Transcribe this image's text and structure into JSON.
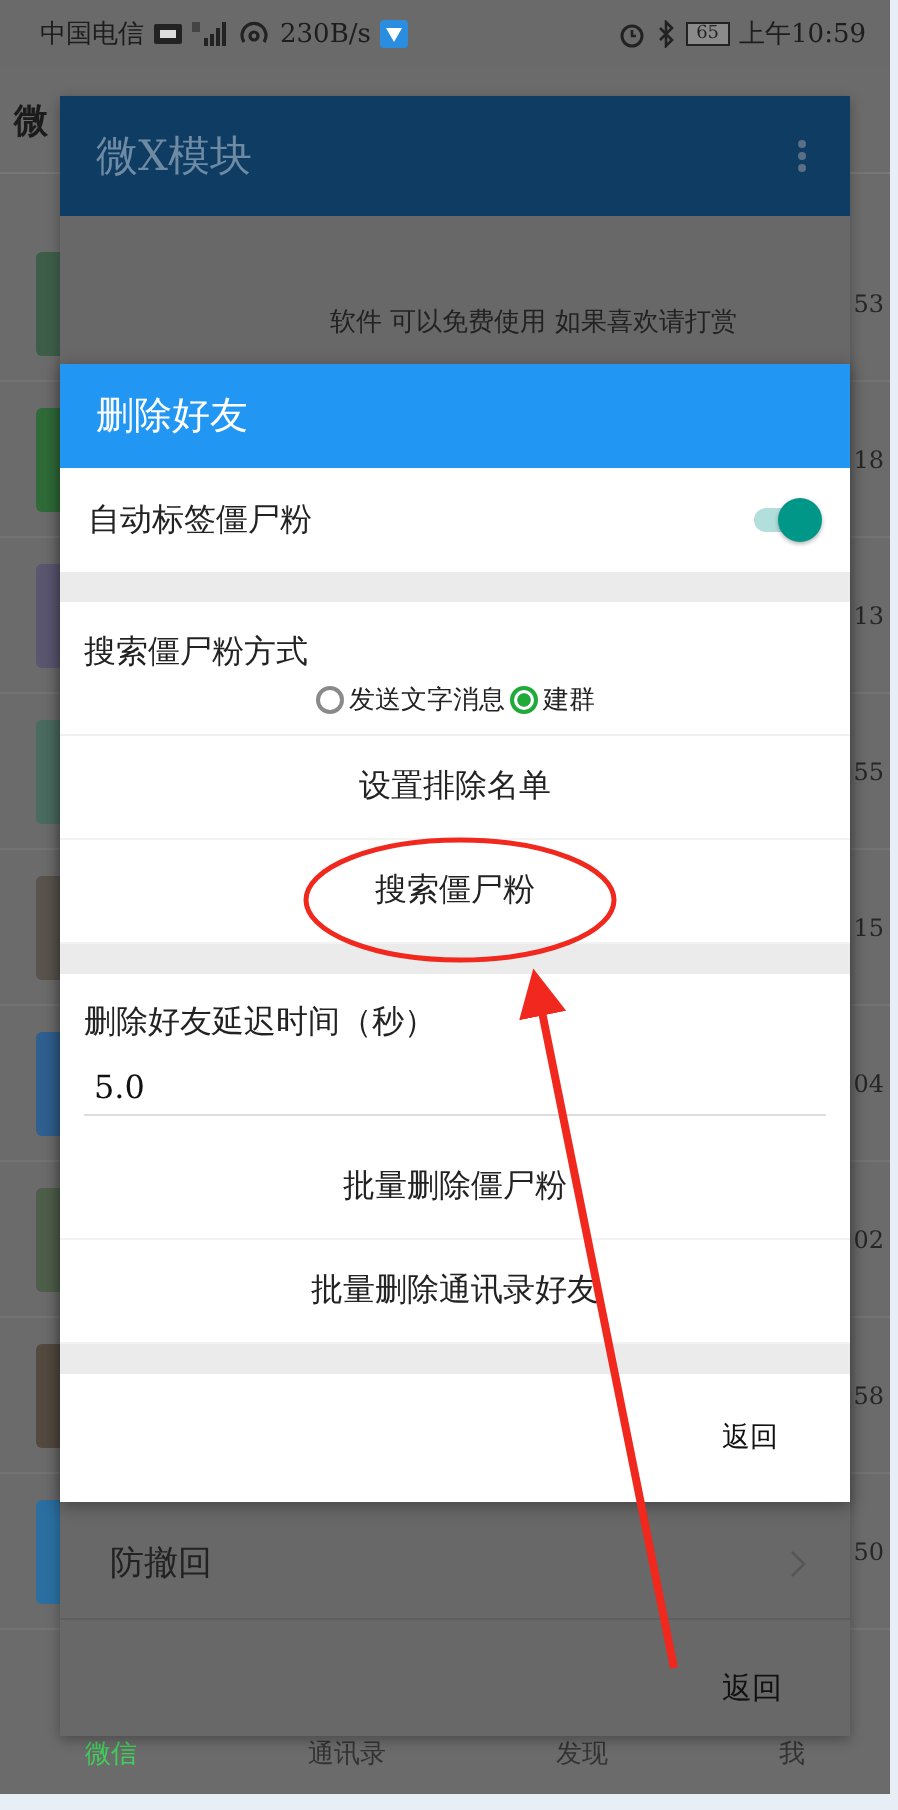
{
  "status_bar": {
    "carrier": "中国电信",
    "speed": "230B/s",
    "battery": "65",
    "time": "上午10:59"
  },
  "background_app": {
    "title": "微",
    "times": [
      "53",
      "18",
      "13",
      "55",
      "15",
      "04",
      "02",
      "58",
      "50"
    ],
    "tabs": [
      {
        "label": "微信",
        "selected": true
      },
      {
        "label": "通讯录",
        "selected": false
      },
      {
        "label": "发现",
        "selected": false
      },
      {
        "label": "我",
        "selected": false
      }
    ]
  },
  "module_dialog": {
    "title": "微X模块",
    "notice": "软件 可以免费使用 如果喜欢请打赏",
    "items": [
      {
        "label": "防撤回"
      }
    ],
    "back_button": "返回"
  },
  "delete_dialog": {
    "title": "删除好友",
    "auto_tag": {
      "label": "自动标签僵尸粉",
      "on": true
    },
    "search_mode": {
      "label": "搜索僵尸粉方式",
      "options": [
        {
          "label": "发送文字消息",
          "selected": false
        },
        {
          "label": "建群",
          "selected": true
        }
      ]
    },
    "actions_1": [
      "设置排除名单",
      "搜索僵尸粉"
    ],
    "delay": {
      "label": "删除好友延迟时间（秒）",
      "value": "5.0"
    },
    "actions_2": [
      "批量删除僵尸粉",
      "批量删除通讯录好友"
    ],
    "back_button": "返回"
  }
}
